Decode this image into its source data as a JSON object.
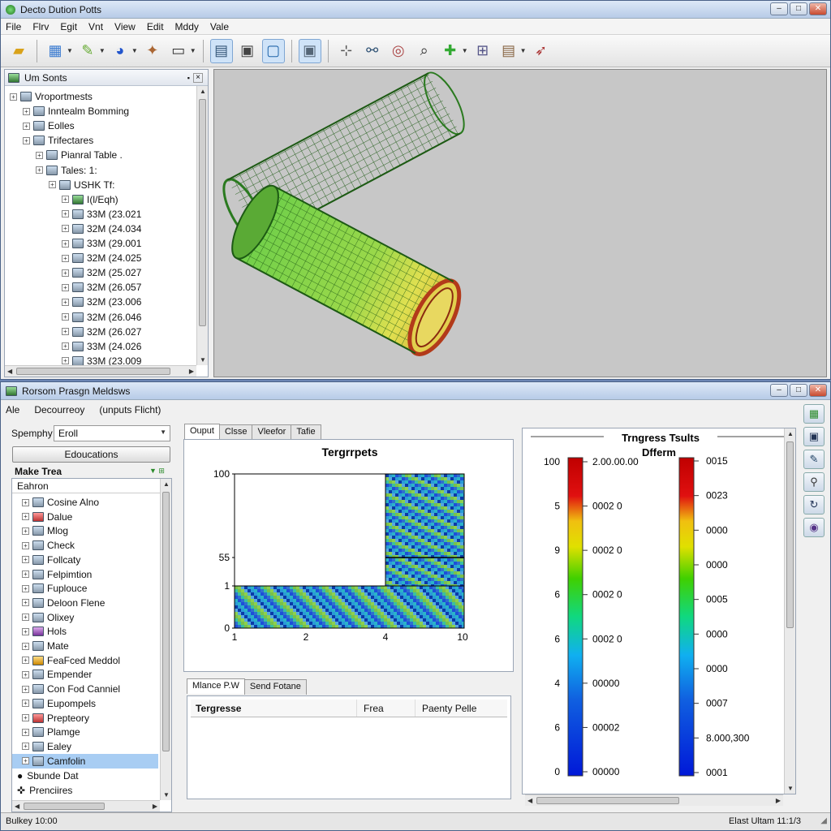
{
  "top_window": {
    "title": "Decto Dution Potts",
    "menu": [
      "File",
      "Flrv",
      "Egit",
      "Vnt",
      "View",
      "Edit",
      "Mddy",
      "Vale"
    ]
  },
  "toolbar_icons": [
    "folder-open-icon",
    "table-tool-icon",
    "brush-icon",
    "globe-icon",
    "pin-icon",
    "monitor-icon",
    "report-icon",
    "save-icon",
    "image-frame-icon",
    "screen-icon",
    "axis-icon",
    "link-icon",
    "zoom-target-icon",
    "zoom-icon",
    "puzzle-icon",
    "grid-icon",
    "clipboard-icon",
    "rocket-icon"
  ],
  "tree_panel": {
    "title": "Um Sonts",
    "items": [
      {
        "label": "Vroportmests",
        "level": 0,
        "icon": "plain"
      },
      {
        "label": "Inntealm Bomming",
        "level": 1,
        "icon": "plain"
      },
      {
        "label": "Eolles",
        "level": 1,
        "icon": "plain"
      },
      {
        "label": "Trifectares",
        "level": 1,
        "icon": "plain"
      },
      {
        "label": "Pianral Table .",
        "level": 2,
        "icon": "plain"
      },
      {
        "label": "Tales: 1:",
        "level": 2,
        "icon": "plain"
      },
      {
        "label": "USHK Tf:",
        "level": 3,
        "icon": "plain"
      },
      {
        "label": "I(l/Eqh)",
        "level": 4,
        "icon": "green"
      },
      {
        "label": "33M (23.021",
        "level": 4,
        "icon": "plain"
      },
      {
        "label": "32M (24.034",
        "level": 4,
        "icon": "plain"
      },
      {
        "label": "33M (29.001",
        "level": 4,
        "icon": "plain"
      },
      {
        "label": "32M (24.025",
        "level": 4,
        "icon": "plain"
      },
      {
        "label": "32M (25.027",
        "level": 4,
        "icon": "plain"
      },
      {
        "label": "32M (26.057",
        "level": 4,
        "icon": "plain"
      },
      {
        "label": "32M (23.006",
        "level": 4,
        "icon": "plain"
      },
      {
        "label": "32M (26.046",
        "level": 4,
        "icon": "plain"
      },
      {
        "label": "32M (26.027",
        "level": 4,
        "icon": "plain"
      },
      {
        "label": "33M (24.026",
        "level": 4,
        "icon": "plain"
      },
      {
        "label": "33M (23.009",
        "level": 4,
        "icon": "plain"
      }
    ]
  },
  "bottom_window": {
    "title": "Rorsom Prasgn Meldsws",
    "menu": [
      "Ale",
      "Decourreoy",
      "(unputs Flicht)"
    ],
    "sidebar": {
      "combo_label": "Spemphy",
      "combo_value": "Eroll",
      "button_label": "Edoucations",
      "section_title": "Make Trea",
      "list_header": "Eahron",
      "items": [
        {
          "label": "Cosine Alno",
          "icon": "plain"
        },
        {
          "label": "Dalue",
          "icon": "red"
        },
        {
          "label": "Mlog",
          "icon": "plain"
        },
        {
          "label": "Check",
          "icon": "plain"
        },
        {
          "label": "Follcaty",
          "icon": "plain"
        },
        {
          "label": "Felpimtion",
          "icon": "plain"
        },
        {
          "label": "Fuplouce",
          "icon": "plain"
        },
        {
          "label": "Deloon Flene",
          "icon": "plain"
        },
        {
          "label": "Olixey",
          "icon": "plain"
        },
        {
          "label": "Hols",
          "icon": "purple"
        },
        {
          "label": "Mate",
          "icon": "plain"
        },
        {
          "label": "FeaFced Meddol",
          "icon": "orange"
        },
        {
          "label": "Empender",
          "icon": "plain"
        },
        {
          "label": "Con Fod Canniel",
          "icon": "plain"
        },
        {
          "label": "Eupompels",
          "icon": "plain"
        },
        {
          "label": "Prepteory",
          "icon": "red"
        },
        {
          "label": "Plamge",
          "icon": "plain"
        },
        {
          "label": "Ealey",
          "icon": "plain"
        },
        {
          "label": "Camfolin",
          "icon": "plain",
          "selected": true
        }
      ],
      "extra_items": [
        "Sbunde Dat",
        "Prenciires"
      ]
    },
    "chart_tabs": [
      "Ouput",
      "Clsse",
      "Vleefor",
      "Tafie"
    ],
    "lower_tabs": [
      "Mlance P.W",
      "Send Fotane"
    ],
    "results_table": {
      "columns": [
        "Tergresse",
        "Frea",
        "Paenty Pelle"
      ]
    },
    "legend": {
      "title": "Trngress Tsults",
      "subtitle": "Dfferm",
      "left_ticks": [
        "100",
        "5",
        "9",
        "6",
        "6",
        "4",
        "6",
        "0"
      ],
      "left_values": [
        "2.00.00.00",
        "0002 0",
        "0002 0",
        "0002 0",
        "0002 0",
        "00000",
        "00002",
        "00000"
      ],
      "right_values": [
        "0015",
        "0023",
        "0000",
        "0000",
        "0005",
        "0000",
        "0000",
        "0007",
        "8.000,300",
        "0001"
      ]
    },
    "side_buttons": [
      "map-icon",
      "window-icon",
      "pen-icon",
      "measure-icon",
      "refresh-icon",
      "help-icon"
    ],
    "status_left": "Bulkey 10:00",
    "status_right": "Elast Ultam 11:1/3"
  },
  "chart_data": {
    "type": "heatmap",
    "title": "Tergrrpets",
    "xlabel": "",
    "ylabel": "",
    "x_ticks": [
      "1",
      "2",
      "4",
      "10"
    ],
    "y_ticks": [
      "100",
      "55",
      "1",
      "0"
    ],
    "regions": [
      {
        "description": "upper-right block",
        "x_range": [
          "4",
          "10"
        ],
        "y_range": [
          "55",
          "100"
        ],
        "filled": true
      },
      {
        "description": "lower band",
        "x_range": [
          "1",
          "10"
        ],
        "y_range": [
          "0",
          "1"
        ],
        "filled": true
      },
      {
        "description": "upper-left empty",
        "x_range": [
          "1",
          "4"
        ],
        "y_range": [
          "1",
          "100"
        ],
        "filled": false
      }
    ]
  },
  "colors": {
    "mesh_green": "#2a7a1f",
    "viewport_bg": "#c7c7c7",
    "selection": "#a8cdf3",
    "scale_top": "#c00000",
    "scale_bottom": "#0018d8"
  }
}
